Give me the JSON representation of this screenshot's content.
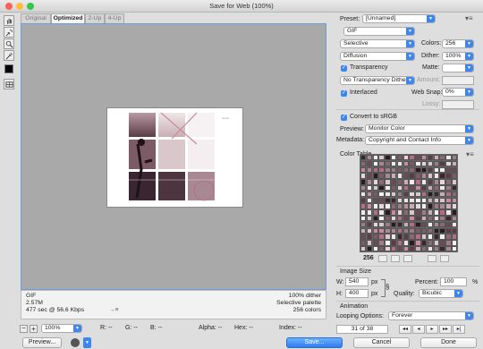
{
  "window": {
    "title": "Save for Web (100%)"
  },
  "tabs": [
    "Original",
    "Optimized",
    "2-Up",
    "4-Up"
  ],
  "info": {
    "format": "GIF",
    "size": "2.57M",
    "time": "477 sec @ 56.6 Kbps",
    "time_menu": "→≡",
    "dither": "100% dither",
    "palette": "Selective palette",
    "colors": "256 colors"
  },
  "statusbar": {
    "zoom": "100%",
    "r": "R: --",
    "g": "G: --",
    "b": "B: --",
    "alpha": "Alpha: --",
    "hex": "Hex: --",
    "index": "Index: --"
  },
  "settings": {
    "preset_label": "Preset:",
    "preset_value": "[Unnamed]",
    "format_value": "GIF",
    "reduction_value": "Selective",
    "colors_label": "Colors:",
    "colors_value": "256",
    "dither_algo_value": "Diffusion",
    "dither_label": "Dither:",
    "dither_value": "100%",
    "transparency_label": "Transparency",
    "matte_label": "Matte:",
    "transparency_dither_value": "No Transparency Dither",
    "amount_label": "Amount:",
    "interlaced_label": "Interlaced",
    "websnap_label": "Web Snap:",
    "websnap_value": "0%",
    "lossy_label": "Lossy:",
    "convert_label": "Convert to sRGB",
    "preview_label": "Preview:",
    "preview_value": "Monitor Color",
    "metadata_label": "Metadata:",
    "metadata_value": "Copyright and Contact Info"
  },
  "color_table": {
    "label": "Color Table",
    "count": "256"
  },
  "image_size": {
    "label": "Image Size",
    "w_label": "W:",
    "w_value": "540",
    "h_label": "H:",
    "h_value": "400",
    "px_w": "px",
    "px_h": "px",
    "percent_label": "Percent:",
    "percent_value": "100",
    "percent_unit": "%",
    "quality_label": "Quality:",
    "quality_value": "Bicubic"
  },
  "animation": {
    "label": "Animation",
    "looping_label": "Looping Options:",
    "looping_value": "Forever",
    "frame": "31 of 38"
  },
  "buttons": {
    "preview": "Preview...",
    "save": "Save...",
    "cancel": "Cancel",
    "done": "Done"
  },
  "colors": {
    "accent": "#3d86f0"
  }
}
